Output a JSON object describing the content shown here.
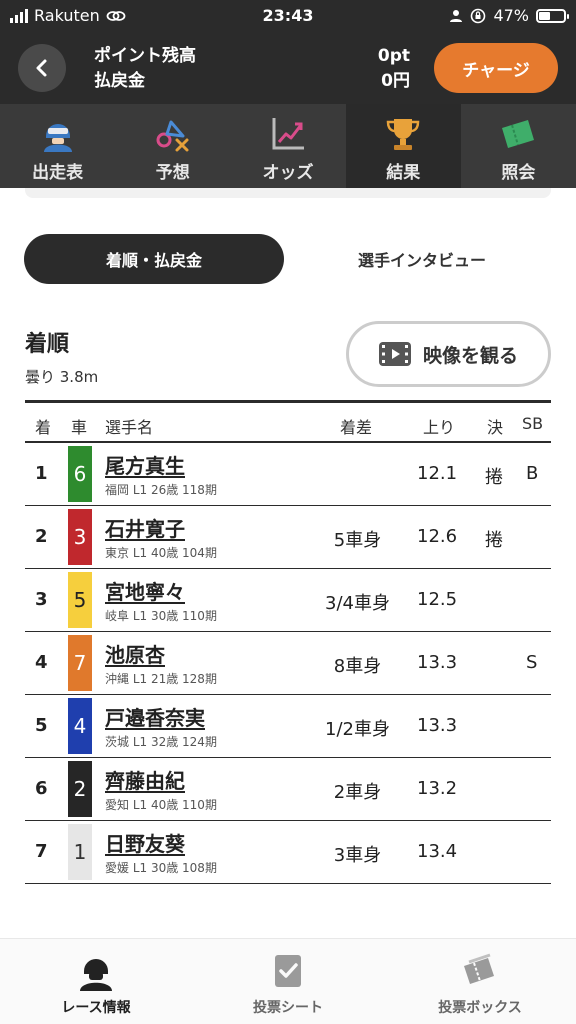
{
  "status_bar": {
    "carrier": "Rakuten",
    "time": "23:43",
    "battery": "47%"
  },
  "header": {
    "points_label": "ポイント残高",
    "refund_label": "払戻金",
    "points_value": "0pt",
    "refund_value": "0円",
    "charge_button": "チャージ"
  },
  "tabs": [
    {
      "label": "出走表",
      "icon": "rider-icon"
    },
    {
      "label": "予想",
      "icon": "prediction-icon"
    },
    {
      "label": "オッズ",
      "icon": "odds-chart-icon"
    },
    {
      "label": "結果",
      "icon": "trophy-icon",
      "active": true
    },
    {
      "label": "照会",
      "icon": "ticket-icon"
    }
  ],
  "subtabs": {
    "active": "着順・払戻金",
    "other": "選手インタビュー"
  },
  "results": {
    "title": "着順",
    "weather": "曇り 3.8m",
    "video_button": "映像を観る",
    "columns": {
      "pos": "着",
      "car": "車",
      "name": "選手名",
      "margin": "着差",
      "time": "上り",
      "kimarite": "決",
      "sb": "SB"
    },
    "rows": [
      {
        "pos": "1",
        "car": "6",
        "name": "尾方真生",
        "meta": "福岡 L1 26歳 118期",
        "margin": "",
        "time": "12.1",
        "kimarite": "捲",
        "sb": "B",
        "car_bg": "#2e8b2e",
        "car_fg": "#ffffff"
      },
      {
        "pos": "2",
        "car": "3",
        "name": "石井寛子",
        "meta": "東京 L1 40歳 104期",
        "margin": "5車身",
        "time": "12.6",
        "kimarite": "捲",
        "sb": "",
        "car_bg": "#c0282d",
        "car_fg": "#ffffff"
      },
      {
        "pos": "3",
        "car": "5",
        "name": "宮地寧々",
        "meta": "岐阜 L1 30歳 110期",
        "margin": "3/4車身",
        "time": "12.5",
        "kimarite": "",
        "sb": "",
        "car_bg": "#f6cf3d",
        "car_fg": "#222222"
      },
      {
        "pos": "4",
        "car": "7",
        "name": "池原杏",
        "meta": "沖縄 L1 21歳 128期",
        "margin": "8車身",
        "time": "13.3",
        "kimarite": "",
        "sb": "S",
        "car_bg": "#e0792c",
        "car_fg": "#ffffff"
      },
      {
        "pos": "5",
        "car": "4",
        "name": "戸邉香奈実",
        "meta": "茨城 L1 32歳 124期",
        "margin": "1/2車身",
        "time": "13.3",
        "kimarite": "",
        "sb": "",
        "car_bg": "#1f3fae",
        "car_fg": "#ffffff"
      },
      {
        "pos": "6",
        "car": "2",
        "name": "齊藤由紀",
        "meta": "愛知 L1 40歳 110期",
        "margin": "2車身",
        "time": "13.2",
        "kimarite": "",
        "sb": "",
        "car_bg": "#262626",
        "car_fg": "#ffffff"
      },
      {
        "pos": "7",
        "car": "1",
        "name": "日野友葵",
        "meta": "愛媛 L1 30歳 108期",
        "margin": "3車身",
        "time": "13.4",
        "kimarite": "",
        "sb": "",
        "car_bg": "#e6e6e6",
        "car_fg": "#333333"
      }
    ]
  },
  "bottom_nav": [
    {
      "label": "レース情報",
      "icon": "rider-icon",
      "active": true
    },
    {
      "label": "投票シート",
      "icon": "vote-sheet-icon"
    },
    {
      "label": "投票ボックス",
      "icon": "vote-box-icon"
    }
  ]
}
